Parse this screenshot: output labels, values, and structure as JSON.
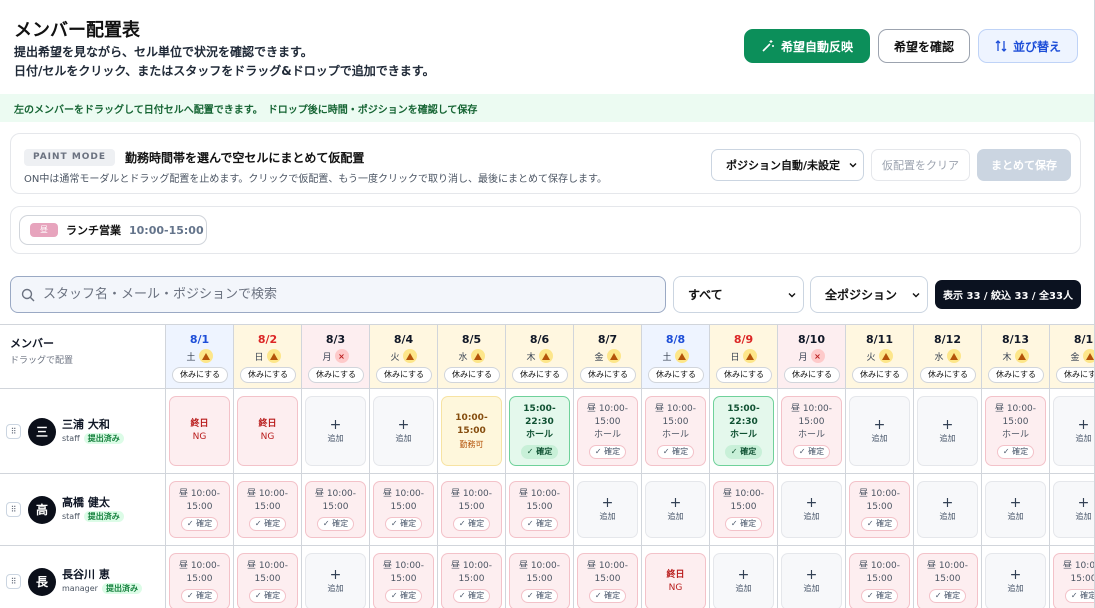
{
  "header": {
    "title": "メンバー配置表",
    "desc1": "提出希望を見ながら、セル単位で状況を確認できます。",
    "desc2": "日付/セルをクリック、またはスタッフをドラッグ&ドロップで追加できます。",
    "btn_auto": "希望自動反映",
    "btn_check": "希望を確認",
    "btn_sort": "並び替え"
  },
  "notice": "左のメンバーをドラッグして日付セルへ配置できます。　ドロップ後に時間・ポジションを確認して保存",
  "paint": {
    "badge": "PAINT MODE",
    "title": "勤務時間帯を選んで空セルにまとめて仮配置",
    "sub": "ON中は通常モーダルとドラッグ配置を止めます。クリックで仮配置、もう一度クリックで取り消し、最後にまとめて保存します。",
    "select": "ポジション自動/未設定",
    "clear": "仮配置をクリア",
    "save": "まとめて保存"
  },
  "shift": {
    "badge": "昼",
    "name": "ランチ営業",
    "time": "10:00-15:00"
  },
  "search": {
    "placeholder": "スタッフ名・メール・ポジションで検索"
  },
  "filter1": "すべて",
  "filter2": "全ポジション",
  "count": "表示 33 / 絞込 33 / 全33人",
  "grid": {
    "member_header": "メンバー",
    "member_sub": "ドラッグで配置",
    "rest_label": "休みにする",
    "colors": {
      "sat": "#1d4ed8",
      "sun": "#dc2626",
      "weekday": "#111827"
    },
    "days": [
      {
        "date": "8/1",
        "dow": "土",
        "mark": "warn",
        "kind": "sat",
        "bg": "#eef4ff"
      },
      {
        "date": "8/2",
        "dow": "日",
        "mark": "warn",
        "kind": "sun",
        "bg": "#fff7e0"
      },
      {
        "date": "8/3",
        "dow": "月",
        "mark": "ng",
        "kind": "weekday",
        "bg": "#fdeef0"
      },
      {
        "date": "8/4",
        "dow": "火",
        "mark": "warn",
        "kind": "weekday",
        "bg": "#fff7e0"
      },
      {
        "date": "8/5",
        "dow": "水",
        "mark": "warn",
        "kind": "weekday",
        "bg": "#fff7e0"
      },
      {
        "date": "8/6",
        "dow": "木",
        "mark": "warn",
        "kind": "weekday",
        "bg": "#fff7e0"
      },
      {
        "date": "8/7",
        "dow": "金",
        "mark": "warn",
        "kind": "weekday",
        "bg": "#fff7e0"
      },
      {
        "date": "8/8",
        "dow": "土",
        "mark": "warn",
        "kind": "sat",
        "bg": "#eef4ff"
      },
      {
        "date": "8/9",
        "dow": "日",
        "mark": "warn",
        "kind": "sun",
        "bg": "#fff7e0"
      },
      {
        "date": "8/10",
        "dow": "月",
        "mark": "ng",
        "kind": "weekday",
        "bg": "#fdeef0"
      },
      {
        "date": "8/11",
        "dow": "火",
        "mark": "warn",
        "kind": "weekday",
        "bg": "#fff7e0"
      },
      {
        "date": "8/12",
        "dow": "水",
        "mark": "warn",
        "kind": "weekday",
        "bg": "#fff7e0"
      },
      {
        "date": "8/13",
        "dow": "木",
        "mark": "warn",
        "kind": "weekday",
        "bg": "#fff7e0"
      },
      {
        "date": "8/1",
        "dow": "金",
        "mark": "warn",
        "kind": "weekday",
        "bg": "#fff7e0"
      }
    ],
    "members": [
      {
        "avatar": "三",
        "name": "三浦 大和",
        "role": "staff",
        "status": "提出済み",
        "cells": [
          {
            "type": "ng",
            "l1": "終日",
            "l2": "NG"
          },
          {
            "type": "ng",
            "l1": "終日",
            "l2": "NG"
          },
          {
            "type": "empty",
            "l2": "追加"
          },
          {
            "type": "empty",
            "l2": "追加"
          },
          {
            "type": "ok",
            "l1": "10:00-15:00",
            "l2": "勤務可"
          },
          {
            "type": "green",
            "l1": "15:00-22:30",
            "l2": "ホール",
            "conf": "✓ 確定"
          },
          {
            "type": "pink",
            "l1": "昼 10:00-",
            "l2": "15:00",
            "l3": "ホール",
            "conf": "✓ 確定"
          },
          {
            "type": "pink",
            "l1": "昼 10:00-",
            "l2": "15:00",
            "l3": "ホール",
            "conf": "✓ 確定"
          },
          {
            "type": "green",
            "l1": "15:00-22:30",
            "l2": "ホール",
            "conf": "✓ 確定"
          },
          {
            "type": "pink",
            "l1": "昼 10:00-",
            "l2": "15:00",
            "l3": "ホール",
            "conf": "✓ 確定"
          },
          {
            "type": "empty",
            "l2": "追加"
          },
          {
            "type": "empty",
            "l2": "追加"
          },
          {
            "type": "pink",
            "l1": "昼 10:00-",
            "l2": "15:00",
            "l3": "ホール",
            "conf": "✓ 確定"
          },
          {
            "type": "empty",
            "l2": "追加"
          }
        ]
      },
      {
        "avatar": "高",
        "name": "高橋 健太",
        "role": "staff",
        "status": "提出済み",
        "cells": [
          {
            "type": "pink",
            "l1": "昼 10:00-",
            "l2": "15:00",
            "conf": "✓ 確定"
          },
          {
            "type": "pink",
            "l1": "昼 10:00-",
            "l2": "15:00",
            "conf": "✓ 確定"
          },
          {
            "type": "pink",
            "l1": "昼 10:00-",
            "l2": "15:00",
            "conf": "✓ 確定"
          },
          {
            "type": "pink",
            "l1": "昼 10:00-",
            "l2": "15:00",
            "conf": "✓ 確定"
          },
          {
            "type": "pink",
            "l1": "昼 10:00-",
            "l2": "15:00",
            "conf": "✓ 確定"
          },
          {
            "type": "pink",
            "l1": "昼 10:00-",
            "l2": "15:00",
            "conf": "✓ 確定"
          },
          {
            "type": "empty",
            "l2": "追加"
          },
          {
            "type": "empty",
            "l2": "追加"
          },
          {
            "type": "pink",
            "l1": "昼 10:00-",
            "l2": "15:00",
            "conf": "✓ 確定"
          },
          {
            "type": "empty",
            "l2": "追加"
          },
          {
            "type": "pink",
            "l1": "昼 10:00-",
            "l2": "15:00",
            "conf": "✓ 確定"
          },
          {
            "type": "empty",
            "l2": "追加"
          },
          {
            "type": "empty",
            "l2": "追加"
          },
          {
            "type": "empty",
            "l2": "追加"
          }
        ]
      },
      {
        "avatar": "長",
        "name": "長谷川 恵",
        "role": "manager",
        "status": "提出済み",
        "cells": [
          {
            "type": "pink",
            "l1": "昼 10:00-",
            "l2": "15:00",
            "conf": "✓ 確定"
          },
          {
            "type": "pink",
            "l1": "昼 10:00-",
            "l2": "15:00",
            "conf": "✓ 確定"
          },
          {
            "type": "empty",
            "l2": "追加"
          },
          {
            "type": "pink",
            "l1": "昼 10:00-",
            "l2": "15:00",
            "conf": "✓ 確定"
          },
          {
            "type": "pink",
            "l1": "昼 10:00-",
            "l2": "15:00",
            "conf": "✓ 確定"
          },
          {
            "type": "pink",
            "l1": "昼 10:00-",
            "l2": "15:00",
            "conf": "✓ 確定"
          },
          {
            "type": "pink",
            "l1": "昼 10:00-",
            "l2": "15:00",
            "conf": "✓ 確定"
          },
          {
            "type": "ng",
            "l1": "終日",
            "l2": "NG"
          },
          {
            "type": "empty",
            "l2": "追加"
          },
          {
            "type": "empty",
            "l2": "追加"
          },
          {
            "type": "pink",
            "l1": "昼 10:00-",
            "l2": "15:00",
            "conf": "✓ 確定"
          },
          {
            "type": "pink",
            "l1": "昼 10:00-",
            "l2": "15:00",
            "conf": "✓ 確定"
          },
          {
            "type": "empty",
            "l2": "追加"
          },
          {
            "type": "pink",
            "l1": "昼 10:00-",
            "l2": "15:00",
            "conf": "✓ 確定"
          }
        ]
      }
    ]
  }
}
